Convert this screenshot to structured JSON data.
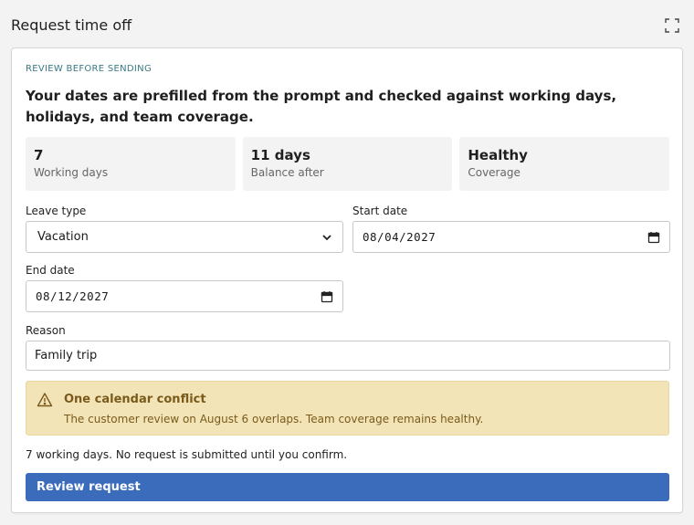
{
  "header": {
    "title": "Request time off"
  },
  "card": {
    "eyebrow": "REVIEW BEFORE SENDING",
    "headline": "Your dates are prefilled from the prompt and checked against working days, holidays, and team coverage."
  },
  "stats": [
    {
      "value": "7",
      "label": "Working days"
    },
    {
      "value": "11 days",
      "label": "Balance after"
    },
    {
      "value": "Healthy",
      "label": "Coverage"
    }
  ],
  "form": {
    "leave_type": {
      "label": "Leave type",
      "value": "Vacation"
    },
    "start_date": {
      "label": "Start date",
      "value": "08/04/2027"
    },
    "end_date": {
      "label": "End date",
      "value": "08/12/2027"
    },
    "reason": {
      "label": "Reason",
      "value": "Family trip"
    }
  },
  "alert": {
    "title": "One calendar conflict",
    "body": "The customer review on August 6 overlaps. Team coverage remains healthy.",
    "icon": "warning-icon",
    "color": "#7a5a1a",
    "background": "#f3e4b8"
  },
  "footnote": "7 working days. No request is submitted until you confirm.",
  "actions": {
    "primary_label": "Review request",
    "primary_color": "#3b6cbc"
  }
}
